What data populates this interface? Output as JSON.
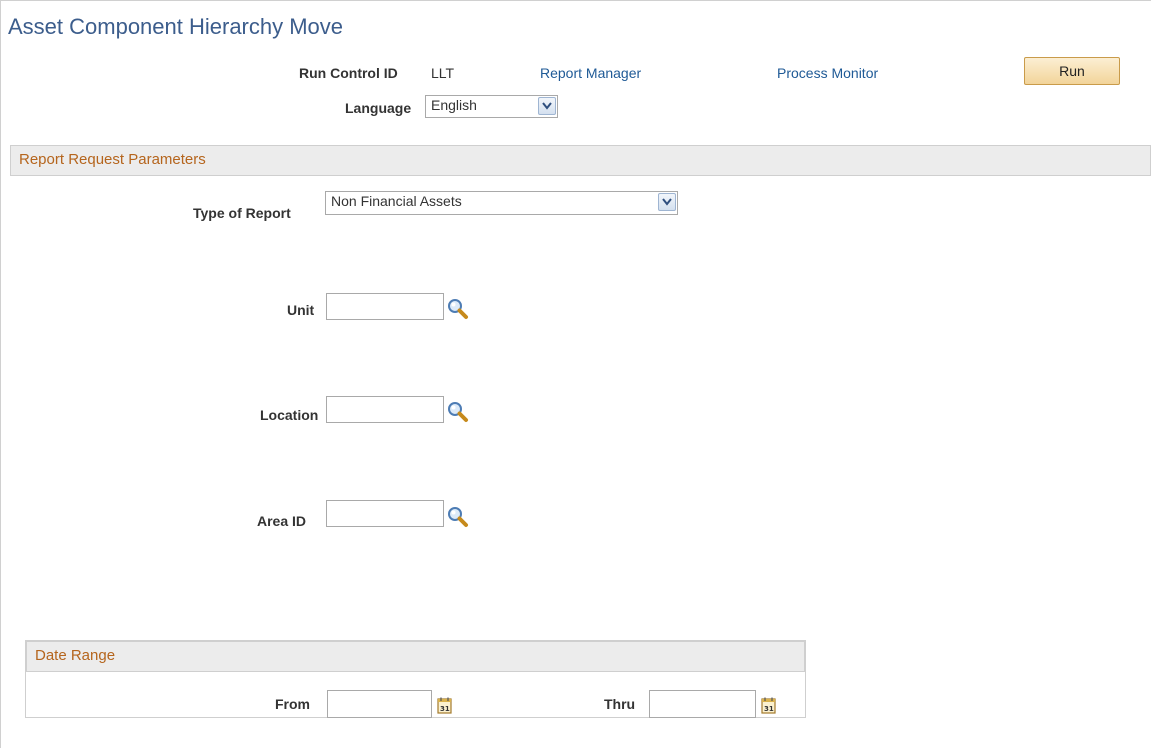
{
  "page": {
    "title": "Asset Component Hierarchy Move"
  },
  "header": {
    "run_control_label": "Run Control ID",
    "run_control_value": "LLT",
    "report_manager_link": "Report Manager",
    "process_monitor_link": "Process Monitor",
    "run_button": "Run",
    "language_label": "Language",
    "language_value": "English"
  },
  "report_params": {
    "section_title": "Report Request Parameters",
    "type_of_report_label": "Type of Report",
    "type_of_report_value": "Non Financial Assets",
    "unit_label": "Unit",
    "unit_value": "",
    "location_label": "Location",
    "location_value": "",
    "area_id_label": "Area ID",
    "area_id_value": ""
  },
  "date_range": {
    "section_title": "Date Range",
    "from_label": "From",
    "from_value": "",
    "thru_label": "Thru",
    "thru_value": ""
  },
  "icons": {
    "lookup": "magnifier-icon",
    "calendar": "calendar-icon",
    "dropdown": "chevron-down-icon"
  },
  "colors": {
    "title": "#3c5d8c",
    "link": "#1f5a96",
    "section_title": "#b5651d",
    "run_button": "#f2d49a"
  }
}
